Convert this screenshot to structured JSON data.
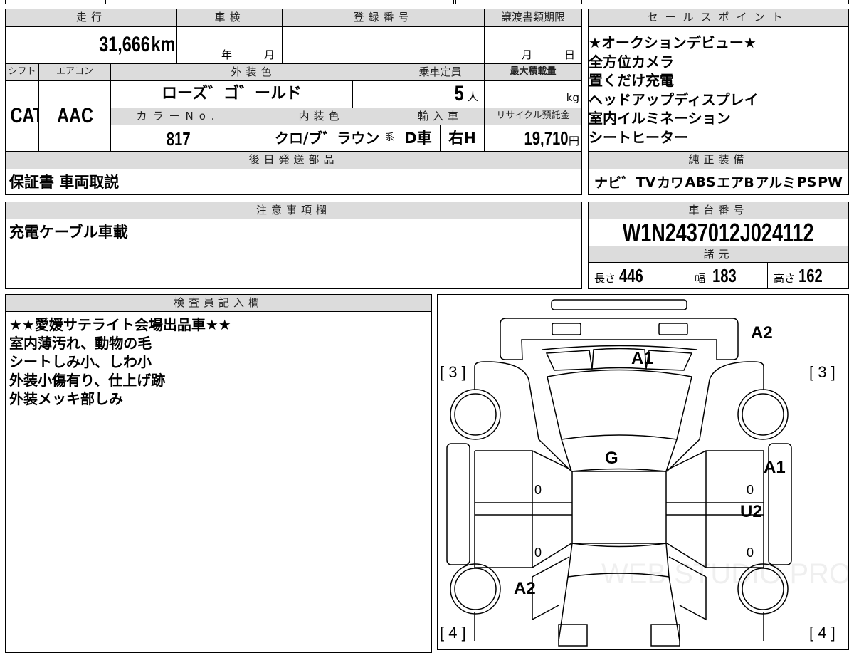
{
  "top": {
    "mileage_label": "走行",
    "mileage": "31,666",
    "mileage_unit": "km",
    "inspection_label": "車検",
    "inspection_year": "年",
    "inspection_month": "月",
    "registration_label": "登録番号",
    "transfer_label": "譲渡書類期限",
    "transfer_month": "月",
    "transfer_day": "日",
    "shift_label": "シフト",
    "shift": "CAT",
    "ac_label": "エアコン",
    "ac": "AAC",
    "exterior_label": "外装色",
    "exterior": "ローズ゛ゴ゛ールド",
    "capacity_label": "乗車定員",
    "capacity": "5",
    "capacity_unit": "人",
    "max_load_label": "最大積載量",
    "max_load_unit": "kg",
    "color_no_label": "カラーNo.",
    "color_no": "817",
    "interior_label": "内装色",
    "interior": "クロ/ブ゛ラウン",
    "interior_suffix": "系",
    "import_label": "輸入車",
    "import_type": "D車",
    "steering": "右H",
    "recycle_label": "リサイクル預託金",
    "recycle": "19,710",
    "recycle_unit": "円",
    "later_parts_label": "後日発送部品",
    "later_parts": "保証書 車両取説"
  },
  "sales": {
    "label": "セールスポイント",
    "items": [
      "★オークションデビュー★",
      "全方位カメラ",
      "置くだけ充電",
      "ヘッドアップディスプレイ",
      "室内イルミネーション",
      "シートヒーター"
    ]
  },
  "equipment": {
    "label": "純正装備",
    "items": [
      "ナビ゛",
      "TV",
      "カワ",
      "ABS",
      "エアB",
      "アルミ",
      "PS",
      "PW"
    ]
  },
  "notes": {
    "label": "注意事項欄",
    "text": "充電ケーブル車載"
  },
  "chassis": {
    "label": "車台番号",
    "value": "W1N2437012J024112"
  },
  "specs": {
    "label": "諸元",
    "length_label": "長さ",
    "length": "446",
    "width_label": "幅",
    "width": "183",
    "height_label": "高さ",
    "height": "162"
  },
  "inspector": {
    "label": "検査員記入欄",
    "lines": [
      "★★愛媛サテライト会場出品車★★",
      "室内薄汚れ、動物の毛",
      "シートしみ小、しわ小",
      "外装小傷有り、仕上げ跡",
      "外装メッキ部しみ"
    ]
  },
  "diagram": {
    "marks": {
      "front_bumper": "A2",
      "grille": "A1",
      "roof": "G",
      "right_front_door": "A1",
      "right_side": "U2",
      "left_rear": "A2"
    },
    "tire_fl": "[ 3 ]",
    "tire_fr": "[ 3 ]",
    "tire_rl": "[ 4 ]",
    "tire_rr": "[ 4 ]",
    "zero": "0",
    "watermark": "WEB STUDIO PRO"
  }
}
